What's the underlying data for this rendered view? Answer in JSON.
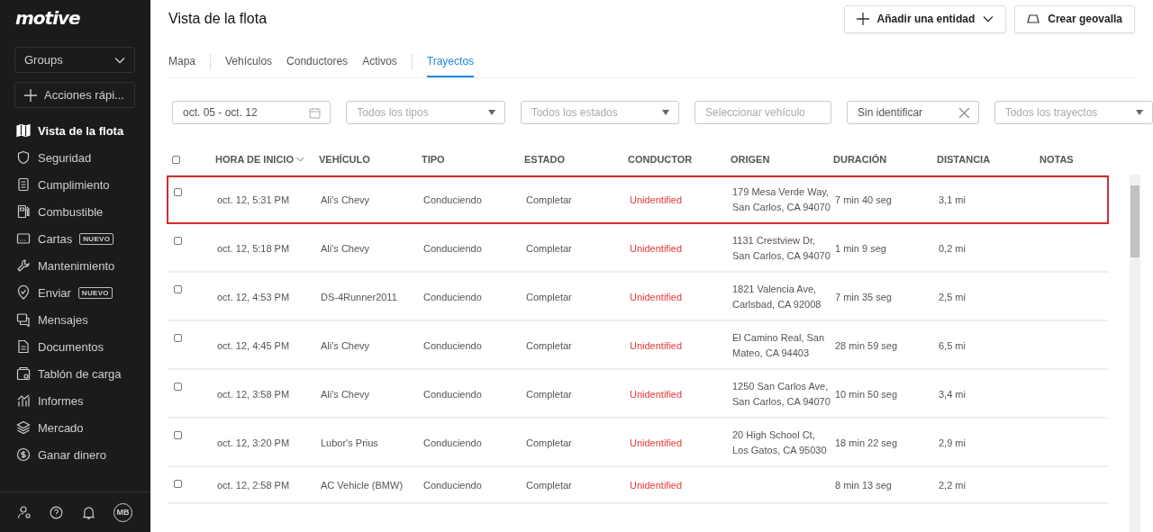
{
  "sidebar": {
    "logo": "motive",
    "groups": "Groups",
    "quick_actions": "Acciones rápi...",
    "items": [
      {
        "label": "Vista de la flota",
        "selected": true
      },
      {
        "label": "Seguridad",
        "selected": false
      },
      {
        "label": "Cumplimiento",
        "selected": false
      },
      {
        "label": "Combustible",
        "selected": false
      },
      {
        "label": "Cartas",
        "selected": false,
        "badge": "NUEVO"
      },
      {
        "label": "Mantenimiento",
        "selected": false
      },
      {
        "label": "Enviar",
        "selected": false,
        "badge": "NUEVO"
      },
      {
        "label": "Mensajes",
        "selected": false
      },
      {
        "label": "Documentos",
        "selected": false
      },
      {
        "label": "Tablón de carga",
        "selected": false
      },
      {
        "label": "Informes",
        "selected": false
      },
      {
        "label": "Mercado",
        "selected": false
      },
      {
        "label": "Ganar dinero",
        "selected": false
      }
    ],
    "avatar": "MB"
  },
  "header": {
    "title": "Vista de la flota",
    "buttons": [
      "Añadir una entidad",
      "Crear geovalla"
    ]
  },
  "tabs": [
    {
      "label": "Mapa",
      "selected": false
    },
    {
      "label": "Vehículos",
      "selected": false
    },
    {
      "label": "Conductores",
      "selected": false
    },
    {
      "label": "Activos",
      "selected": false
    },
    {
      "label": "Trayectos",
      "selected": true
    }
  ],
  "filters": [
    {
      "kind": "date",
      "value": "oct. 05 - oct. 12"
    },
    {
      "kind": "select",
      "placeholder": "Todos los tipos"
    },
    {
      "kind": "select",
      "placeholder": "Todos los estados"
    },
    {
      "kind": "input",
      "placeholder": "Seleccionar vehículo"
    },
    {
      "kind": "clearable",
      "value": "Sin identificar"
    },
    {
      "kind": "select",
      "placeholder": "Todos los trayectos"
    }
  ],
  "table": {
    "select_all_checked": false,
    "columns": [
      {
        "label": "HORA DE INICIO",
        "sorted": true
      },
      {
        "label": "VEHÍCULO",
        "sorted": false
      },
      {
        "label": "TIPO",
        "sorted": false
      },
      {
        "label": "ESTADO",
        "sorted": false
      },
      {
        "label": "CONDUCTOR",
        "sorted": false
      },
      {
        "label": "ORIGEN",
        "sorted": false
      },
      {
        "label": "DURACIÓN",
        "sorted": false
      },
      {
        "label": "DISTANCIA",
        "sorted": false
      },
      {
        "label": "NOTAS",
        "sorted": false
      }
    ],
    "rows": [
      {
        "checked": false,
        "highlighted": true,
        "start": "oct. 12, 5:31 PM",
        "vehicle": "Ali's Chevy",
        "type": "Conduciendo",
        "status": "Completar",
        "driver": "Unidentified",
        "origin": "179 Mesa Verde Way, San Carlos, CA 94070",
        "duration": "7 min 40 seg",
        "distance": "3,1 mi"
      },
      {
        "checked": false,
        "highlighted": false,
        "start": "oct. 12, 5:18 PM",
        "vehicle": "Ali's Chevy",
        "type": "Conduciendo",
        "status": "Completar",
        "driver": "Unidentified",
        "origin": "1131 Crestview Dr, San Carlos, CA 94070",
        "duration": "1 min 9 seg",
        "distance": "0,2 mi"
      },
      {
        "checked": false,
        "highlighted": false,
        "start": "oct. 12, 4:53 PM",
        "vehicle": "DS-4Runner2011",
        "type": "Conduciendo",
        "status": "Completar",
        "driver": "Unidentified",
        "origin": "1821 Valencia Ave, Carlsbad, CA 92008",
        "duration": "7 min 35 seg",
        "distance": "2,5 mi"
      },
      {
        "checked": false,
        "highlighted": false,
        "start": "oct. 12, 4:45 PM",
        "vehicle": "Ali's Chevy",
        "type": "Conduciendo",
        "status": "Completar",
        "driver": "Unidentified",
        "origin": "El Camino Real, San Mateo, CA 94403",
        "duration": "28 min 59 seg",
        "distance": "6,5 mi"
      },
      {
        "checked": false,
        "highlighted": false,
        "start": "oct. 12, 3:58 PM",
        "vehicle": "Ali's Chevy",
        "type": "Conduciendo",
        "status": "Completar",
        "driver": "Unidentified",
        "origin": "1250 San Carlos Ave, San Carlos, CA 94070",
        "duration": "10 min 50 seg",
        "distance": "3,4 mi"
      },
      {
        "checked": false,
        "highlighted": false,
        "start": "oct. 12, 3:20 PM",
        "vehicle": "Lubor's Prius",
        "type": "Conduciendo",
        "status": "Completar",
        "driver": "Unidentified",
        "origin": "20 High School Ct, Los Gatos, CA 95030",
        "duration": "18 min 22 seg",
        "distance": "2,9 mi"
      },
      {
        "checked": false,
        "highlighted": false,
        "start": "oct. 12, 2:58 PM",
        "vehicle": "AC Vehicle (BMW)",
        "type": "Conduciendo",
        "status": "Completar",
        "driver": "Unidentified",
        "duration": "8 min 13 seg",
        "distance": "2,2 mi"
      }
    ]
  }
}
